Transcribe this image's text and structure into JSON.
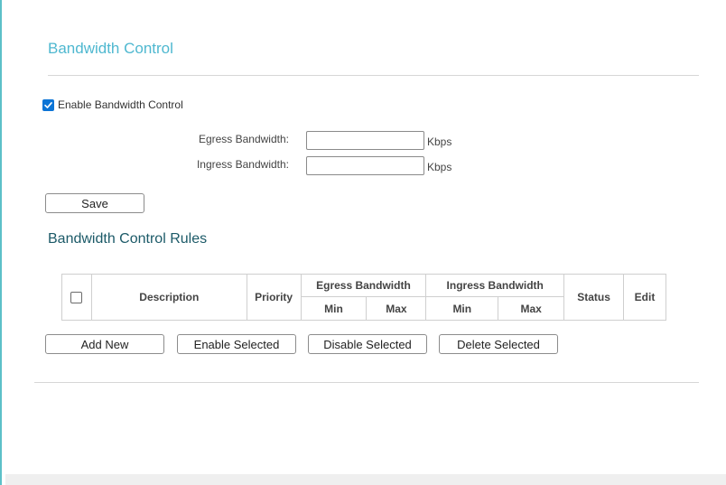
{
  "header": {
    "title": "Bandwidth Control"
  },
  "enable": {
    "label": "Enable Bandwidth Control",
    "checked": true
  },
  "fields": {
    "egress": {
      "label": "Egress Bandwidth:",
      "value": "",
      "unit": "Kbps"
    },
    "ingress": {
      "label": "Ingress Bandwidth:",
      "value": "",
      "unit": "Kbps"
    }
  },
  "buttons": {
    "save": "Save",
    "add_new": "Add New",
    "enable_selected": "Enable Selected",
    "disable_selected": "Disable Selected",
    "delete_selected": "Delete Selected"
  },
  "rules": {
    "title": "Bandwidth Control Rules",
    "columns": {
      "description": "Description",
      "priority": "Priority",
      "egress": "Egress Bandwidth",
      "ingress": "Ingress Bandwidth",
      "status": "Status",
      "edit": "Edit",
      "min": "Min",
      "max": "Max"
    },
    "rows": []
  },
  "colors": {
    "accent": "#4fb8d0",
    "section_title": "#1c5a68",
    "checkbox": "#0b74d6"
  },
  "icons": {
    "check": "check-icon"
  }
}
